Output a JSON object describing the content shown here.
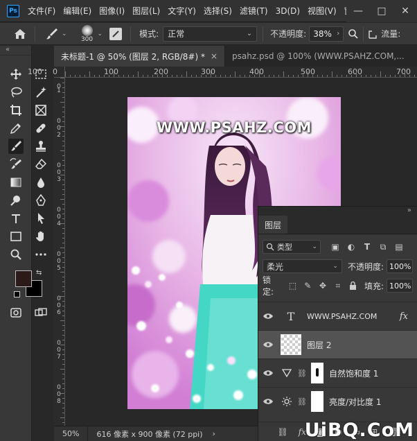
{
  "menubar": {
    "logo": "Ps",
    "items": [
      "文件(F)",
      "编辑(E)",
      "图像(I)",
      "图层(L)",
      "文字(Y)",
      "选择(S)",
      "滤镜(T)",
      "3D(D)",
      "视图(V)",
      "窗"
    ],
    "minimize": "—",
    "maximize": "□",
    "close": "✕"
  },
  "options": {
    "brush_size": "300",
    "mode_label": "模式:",
    "mode_value": "正常",
    "opacity_label": "不透明度:",
    "opacity_value": "38%",
    "flow_label": "流量:"
  },
  "tabs": [
    {
      "label": "未标题-1 @ 50% (图层 2, RGB/8#) *",
      "close": "×"
    },
    {
      "label": "psahz.psd @ 100% (WWW.PSAHZ.COM,...",
      "close": "×"
    }
  ],
  "ruler": {
    "h_labels": [
      "100",
      "0",
      "100",
      "200",
      "300",
      "400",
      "500",
      "600",
      "700"
    ],
    "v_labels": [
      "0",
      "1",
      "0",
      "0",
      "2",
      "0",
      "0",
      "3",
      "0",
      "0",
      "4",
      "0",
      "0",
      "5",
      "0",
      "0",
      "6",
      "0",
      "0",
      "7",
      "0",
      "0",
      "8",
      "0",
      "0",
      "9",
      "0",
      "0"
    ]
  },
  "canvas": {
    "watermark": "WWW.PSAHZ.COM"
  },
  "status": {
    "zoom": "50%",
    "doc_info": "616 像素 x 900 像素 (72 ppi)",
    "arrow": "›"
  },
  "layers_panel": {
    "tab": "图层",
    "filter_value": "类型",
    "blend_mode": "柔光",
    "opacity_label": "不透明度:",
    "opacity_value": "100%",
    "lock_label": "锁定:",
    "fill_label": "填充:",
    "fill_value": "100%",
    "layers": [
      {
        "name": "WWW.PSAHZ.COM",
        "type": "text",
        "fx": "fx"
      },
      {
        "name": "图层 2",
        "type": "pixel",
        "selected": true
      },
      {
        "name": "自然饱和度 1",
        "type": "vibrance"
      },
      {
        "name": "亮度/对比度 1",
        "type": "brightness"
      }
    ],
    "fx_footer": "fx"
  },
  "site_watermark": "UiBQ.CoM",
  "colors": {
    "foreground": "#2a1a1a",
    "background": "#000000",
    "accent": "#31a8ff"
  }
}
